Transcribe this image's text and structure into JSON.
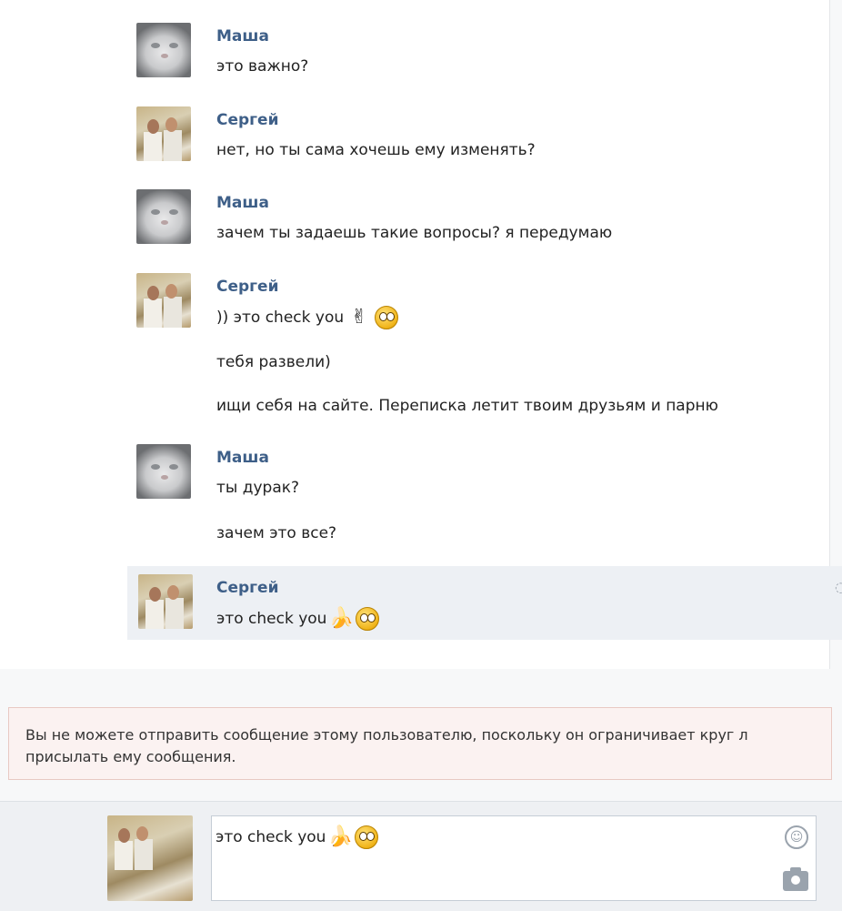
{
  "messages": [
    {
      "author": "Маша",
      "avatar": "cat",
      "lines": [
        "это важно?"
      ]
    },
    {
      "author": "Сергей",
      "avatar": "photo",
      "lines": [
        "нет, но ты сама хочешь ему изменять?"
      ]
    },
    {
      "author": "Маша",
      "avatar": "cat",
      "lines": [
        "зачем ты задаешь такие вопросы? я передумаю"
      ]
    },
    {
      "author": "Сергей",
      "avatar": "photo",
      "lines": [
        ")) это check you",
        "тебя развели)",
        "ищи себя на сайте. Переписка летит твоим друзьям и парню"
      ]
    },
    {
      "author": "Маша",
      "avatar": "cat",
      "lines": [
        "ты дурак?",
        "зачем это все?"
      ]
    },
    {
      "author": "Сергей",
      "avatar": "photo",
      "lines": [
        "это check you"
      ]
    }
  ],
  "icons": {
    "peace_hand": "✌",
    "banana": "🍌",
    "smiley": "smiley-face-icon",
    "emoji_picker": "smile-icon",
    "camera": "camera-icon"
  },
  "notice": {
    "line1": "Вы не можете отправить сообщение этому пользователю, поскольку он ограничивает круг л",
    "line2": "присылать ему сообщения."
  },
  "composer": {
    "value": "это check you"
  },
  "colors": {
    "author": "#3e5f88",
    "highlight": "#edf0f4",
    "notice_bg": "#fbf2f1"
  }
}
